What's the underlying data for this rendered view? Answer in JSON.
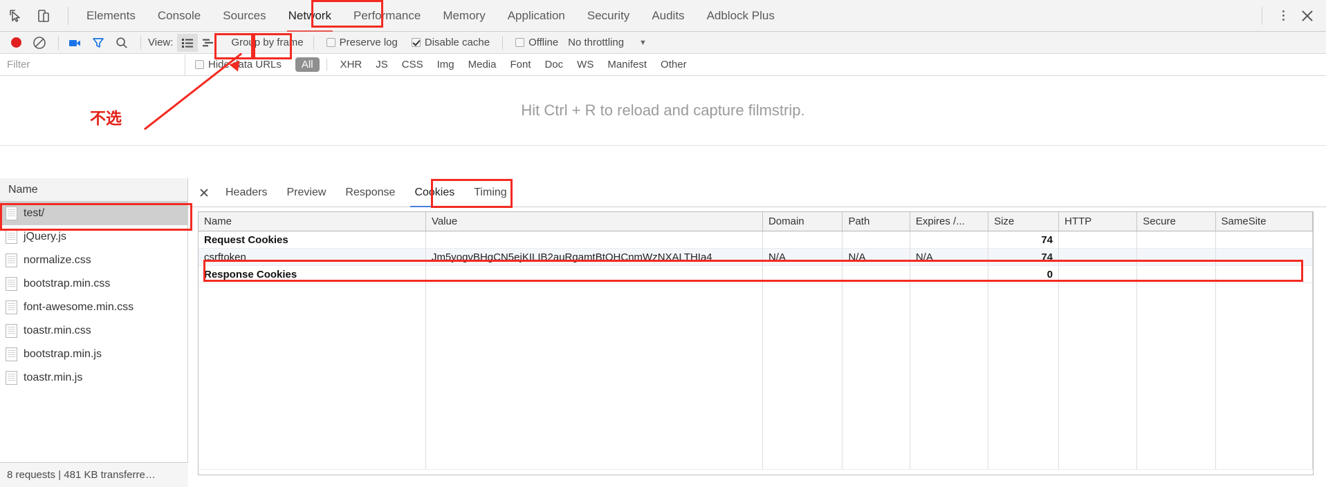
{
  "window": {
    "tabs": [
      {
        "label": "Elements",
        "active": false
      },
      {
        "label": "Console",
        "active": false
      },
      {
        "label": "Sources",
        "active": false
      },
      {
        "label": "Network",
        "active": true
      },
      {
        "label": "Performance",
        "active": false
      },
      {
        "label": "Memory",
        "active": false
      },
      {
        "label": "Application",
        "active": false
      },
      {
        "label": "Security",
        "active": false
      },
      {
        "label": "Audits",
        "active": false
      },
      {
        "label": "Adblock Plus",
        "active": false
      }
    ],
    "inspect_icon": "inspect-element-icon",
    "device_icon": "device-toolbar-icon",
    "more_icon": "more-options-icon",
    "close_icon": "close-icon"
  },
  "toolbar": {
    "record_icon": "record-icon",
    "clear_icon": "clear-icon",
    "camera_icon": "capture-screenshots-icon",
    "filter_icon": "filter-icon",
    "search_icon": "search-icon",
    "view_label": "View:",
    "view_list_icon": "list-view-icon",
    "view_waterfall_icon": "waterfall-view-icon",
    "group_by_frame": "Group by frame",
    "preserve_log": "Preserve log",
    "preserve_log_checked": false,
    "disable_cache": "Disable cache",
    "disable_cache_checked": true,
    "offline": "Offline",
    "offline_checked": false,
    "throttling": "No throttling",
    "throttling_caret": "▼"
  },
  "filterbar": {
    "filter_placeholder": "Filter",
    "filter_value": "",
    "hide_data_urls": "Hide data URLs",
    "hide_data_urls_checked": false,
    "types": [
      {
        "label": "All",
        "active": true
      },
      {
        "label": "XHR",
        "active": false
      },
      {
        "label": "JS",
        "active": false
      },
      {
        "label": "CSS",
        "active": false
      },
      {
        "label": "Img",
        "active": false
      },
      {
        "label": "Media",
        "active": false
      },
      {
        "label": "Font",
        "active": false
      },
      {
        "label": "Doc",
        "active": false
      },
      {
        "label": "WS",
        "active": false
      },
      {
        "label": "Manifest",
        "active": false
      },
      {
        "label": "Other",
        "active": false
      }
    ]
  },
  "filmstrip": {
    "hint": "Hit Ctrl + R to reload and capture filmstrip."
  },
  "annotation": {
    "note_text": "不选"
  },
  "requests": {
    "column_header": "Name",
    "items": [
      {
        "name": "test/",
        "selected": true
      },
      {
        "name": "jQuery.js",
        "selected": false
      },
      {
        "name": "normalize.css",
        "selected": false
      },
      {
        "name": "bootstrap.min.css",
        "selected": false
      },
      {
        "name": "font-awesome.min.css",
        "selected": false
      },
      {
        "name": "toastr.min.css",
        "selected": false
      },
      {
        "name": "bootstrap.min.js",
        "selected": false
      },
      {
        "name": "toastr.min.js",
        "selected": false
      }
    ],
    "status": "8 requests  |  481 KB transferre…"
  },
  "details": {
    "close_icon": "close-icon",
    "tabs": [
      {
        "label": "Headers",
        "active": false
      },
      {
        "label": "Preview",
        "active": false
      },
      {
        "label": "Response",
        "active": false
      },
      {
        "label": "Cookies",
        "active": true
      },
      {
        "label": "Timing",
        "active": false
      }
    ]
  },
  "cookies_table": {
    "columns": [
      "Name",
      "Value",
      "Domain",
      "Path",
      "Expires /...",
      "Size",
      "HTTP",
      "Secure",
      "SameSite"
    ],
    "rows": [
      {
        "type": "group",
        "cells": [
          "Request Cookies",
          "",
          "",
          "",
          "",
          "74",
          "",
          "",
          ""
        ]
      },
      {
        "type": "data",
        "cells": [
          "csrftoken",
          "Jm5yogvBHgCN5ejKILIB2auRgamtBtOHCnmWzNXALTHIa4",
          "N/A",
          "N/A",
          "N/A",
          "74",
          "",
          "",
          ""
        ]
      },
      {
        "type": "group",
        "cells": [
          "Response Cookies",
          "",
          "",
          "",
          "",
          "0",
          "",
          "",
          ""
        ]
      }
    ]
  },
  "colors": {
    "annotation_red": "#f42a21",
    "record_red": "#e02020",
    "active_tab_underline": "#e8554e",
    "details_tab_underline": "#4a7fe0",
    "selection_gray": "#cfcfcf"
  }
}
